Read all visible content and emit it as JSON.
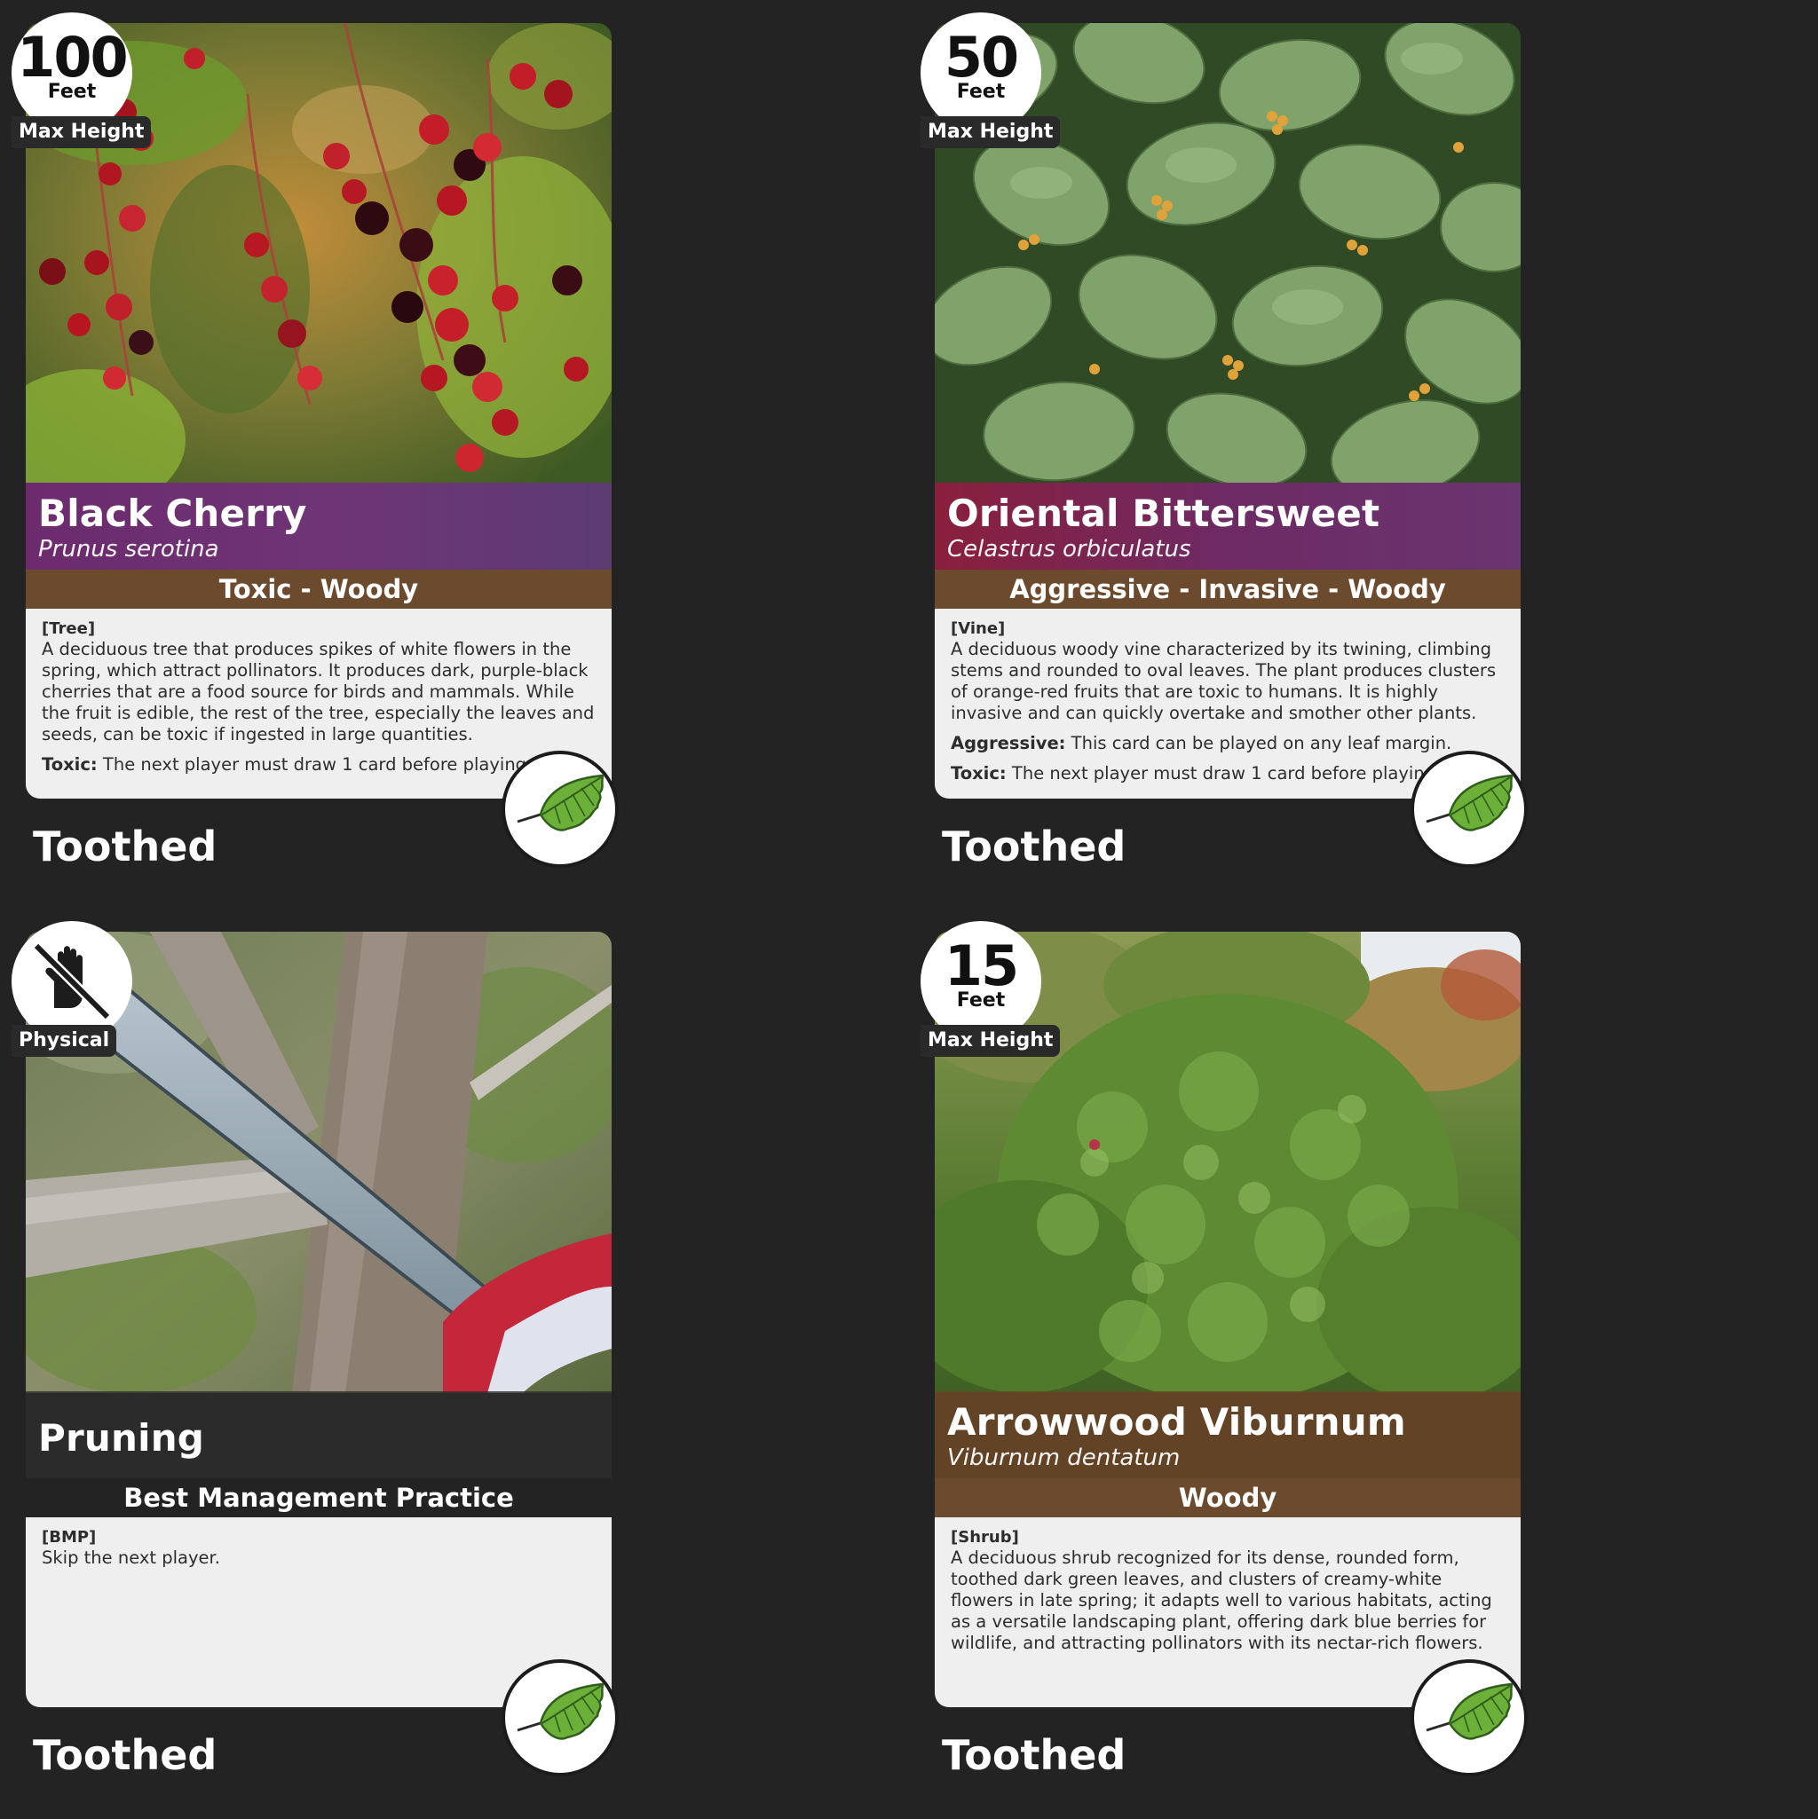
{
  "footer_label": "Toothed",
  "height_unit": "Feet",
  "height_label": "Max Height",
  "cards": [
    {
      "name": "Black Cherry",
      "scientific": "Prunus serotina",
      "type_line": "Toxic - Woody",
      "category": "[Tree]",
      "description": "A deciduous tree that produces spikes of white flowers in the spring, which attract pollinators. It produces dark, purple-black cherries that are a food source for birds and mammals. While the fruit is edible, the rest of the tree, especially the leaves and seeds, can be toxic if ingested in large quantities.",
      "ability1_key": "Toxic:",
      "ability1_text": " The next player must draw 1 card before playing.",
      "max_height": "100"
    },
    {
      "name": "Oriental Bittersweet",
      "scientific": "Celastrus orbiculatus",
      "type_line": "Aggressive - Invasive - Woody",
      "category": "[Vine]",
      "description": "A deciduous woody vine characterized by its twining, climbing stems and rounded to oval leaves. The plant produces clusters of orange-red fruits that are toxic to humans. It is highly invasive and can quickly overtake and smother other plants.",
      "ability1_key": "Aggressive:",
      "ability1_text": " This card can be played on any leaf margin.",
      "ability2_key": "Toxic:",
      "ability2_text": " The next player must draw 1 card before playing.",
      "max_height": "50"
    },
    {
      "name": "Pruning",
      "type_line": "Best Management Practice",
      "category": "[BMP]",
      "description": "Skip the next player.",
      "badge_label": "Physical",
      "badge_icon": "no-hand-icon"
    },
    {
      "name": "Arrowwood Viburnum",
      "scientific": "Viburnum dentatum",
      "type_line": "Woody",
      "category": "[Shrub]",
      "description": "A deciduous shrub recognized for its dense, rounded form, toothed dark green leaves, and clusters of creamy-white flowers in late spring; it adapts well to various habitats, acting as a versatile landscaping plant, offering dark blue berries for wildlife, and attracting pollinators with its nectar-rich flowers.",
      "max_height": "15"
    }
  ]
}
